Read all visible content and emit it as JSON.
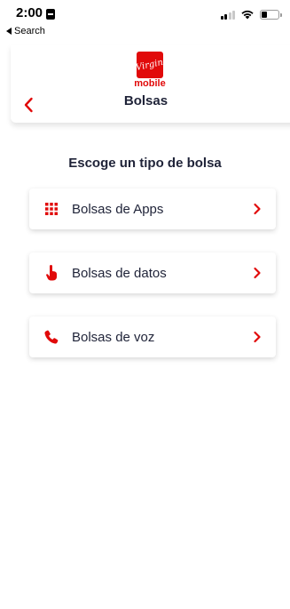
{
  "status_bar": {
    "time": "2:00",
    "back_app": "Search"
  },
  "header": {
    "logo_word": "mobile",
    "logo_script": "Virgin",
    "title": "Bolsas",
    "accent_color": "#e10a0a"
  },
  "main": {
    "heading": "Escoge un tipo de bolsa",
    "options": [
      {
        "label": "Bolsas de Apps",
        "icon": "apps-grid-icon"
      },
      {
        "label": "Bolsas de datos",
        "icon": "touch-hand-icon"
      },
      {
        "label": "Bolsas de voz",
        "icon": "phone-icon"
      }
    ]
  }
}
